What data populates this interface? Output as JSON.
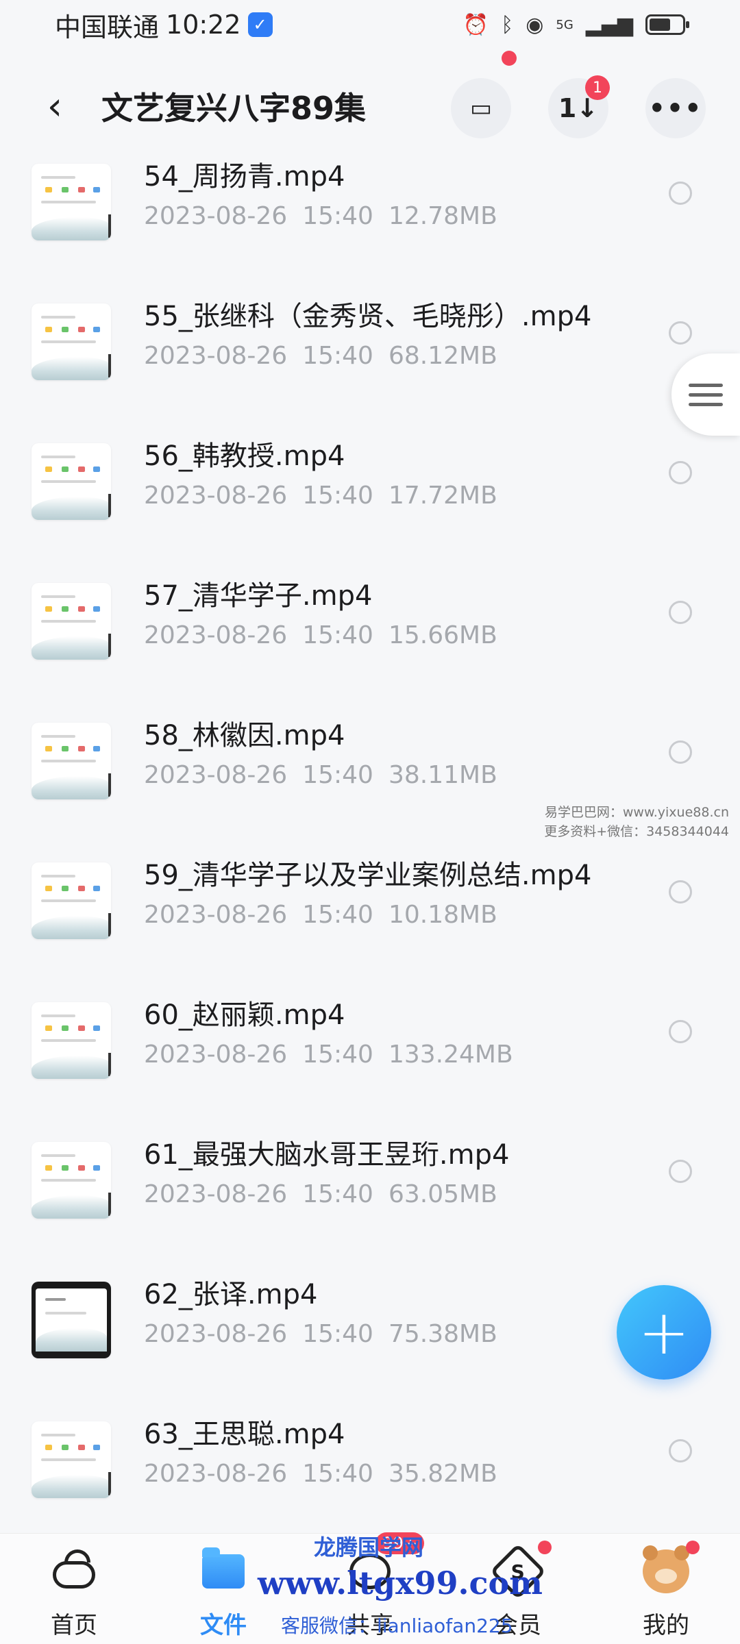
{
  "status_bar": {
    "carrier": "中国联通",
    "time": "10:22",
    "badge_icon": "shield-icon",
    "icons": [
      "alarm-icon",
      "bluetooth-icon",
      "hotspot-icon",
      "signal-icon",
      "battery-icon"
    ],
    "network": "5G"
  },
  "header": {
    "title": "文艺复兴八字89集",
    "back_icon": "back-arrow-icon",
    "actions": [
      {
        "name": "transfer-list",
        "icon": "archive-icon",
        "has_dot": true
      },
      {
        "name": "sort",
        "icon": "sort-icon",
        "badge": "1"
      },
      {
        "name": "more",
        "icon": "more-icon"
      }
    ]
  },
  "files": [
    {
      "name": "54_周扬青.mp4",
      "date": "2023-08-26",
      "time": "15:40",
      "size": "12.78MB"
    },
    {
      "name": "55_张继科（金秀贤、毛晓彤）.mp4",
      "date": "2023-08-26",
      "time": "15:40",
      "size": "68.12MB"
    },
    {
      "name": "56_韩教授.mp4",
      "date": "2023-08-26",
      "time": "15:40",
      "size": "17.72MB"
    },
    {
      "name": "57_清华学子.mp4",
      "date": "2023-08-26",
      "time": "15:40",
      "size": "15.66MB"
    },
    {
      "name": "58_林徽因.mp4",
      "date": "2023-08-26",
      "time": "15:40",
      "size": "38.11MB"
    },
    {
      "name": "59_清华学子以及学业案例总结.mp4",
      "date": "2023-08-26",
      "time": "15:40",
      "size": "10.18MB"
    },
    {
      "name": "60_赵丽颖.mp4",
      "date": "2023-08-26",
      "time": "15:40",
      "size": "133.24MB"
    },
    {
      "name": "61_最强大脑水哥王昱珩.mp4",
      "date": "2023-08-26",
      "time": "15:40",
      "size": "63.05MB"
    },
    {
      "name": "62_张译.mp4",
      "date": "2023-08-26",
      "time": "15:40",
      "size": "75.38MB"
    },
    {
      "name": "63_王思聪.mp4",
      "date": "2023-08-26",
      "time": "15:40",
      "size": "35.82MB"
    }
  ],
  "watermark_side": {
    "line1": "易学巴巴网：www.yixue88.cn",
    "line2": "更多资料+微信：3458344044"
  },
  "fab": {
    "icon": "plus-icon"
  },
  "bottom_nav": {
    "items": [
      {
        "label": "首页",
        "icon": "cloud-home-icon",
        "active": false
      },
      {
        "label": "文件",
        "icon": "folder-icon",
        "active": true
      },
      {
        "label": "共享",
        "icon": "share-icon",
        "badge": "99+"
      },
      {
        "label": "会员",
        "icon": "vip-icon",
        "has_dot": true
      },
      {
        "label": "我的",
        "icon": "avatar-bear-icon",
        "has_dot": true
      }
    ]
  },
  "watermark_overlay": {
    "brand": "龙腾国学网",
    "url": "www.ltgx99.com",
    "contact": "客服微信：lianliaofan225"
  },
  "colors": {
    "accent": "#2f8cf5",
    "badge_red": "#f2445a",
    "meta_gray": "#a5a8ad",
    "background": "#f6f7f9"
  }
}
